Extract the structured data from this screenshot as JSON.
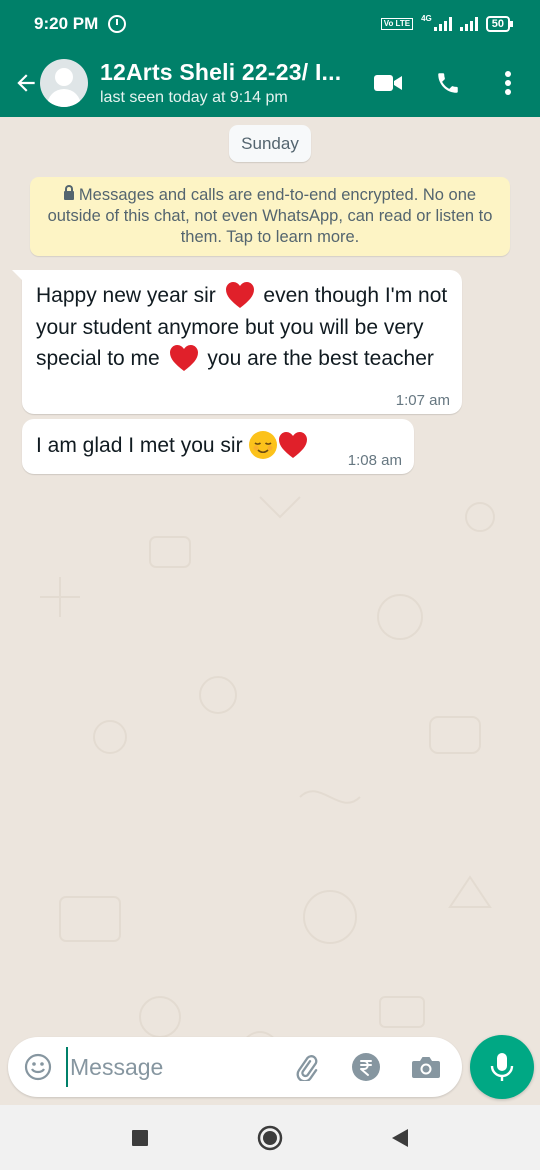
{
  "status_bar": {
    "time": "9:20 PM",
    "network": "4G",
    "volte": "Vo LTE",
    "battery": "50"
  },
  "header": {
    "contact_name": "12Arts Sheli 22-23/ I...",
    "last_seen": "last seen today at 9:14 pm",
    "icons": [
      "back-arrow-icon",
      "avatar",
      "video-call-icon",
      "phone-icon",
      "more-vert-icon"
    ]
  },
  "chat": {
    "date_chip": "Sunday",
    "encryption_notice": "Messages and calls are end-to-end encrypted. No one outside of this chat, not even WhatsApp, can read or listen to them. Tap to learn more.",
    "messages": [
      {
        "parts": [
          "Happy new year sir ",
          " even though I'm not your student anymore but you will be very special to me ",
          " you are the best teacher"
        ],
        "time": "1:07 am"
      },
      {
        "parts": [
          "I am glad I met you sir "
        ],
        "time": "1:08 am"
      }
    ]
  },
  "input_bar": {
    "placeholder": "Message",
    "icons": [
      "emoji-icon",
      "attach-icon",
      "rupee-payment-icon",
      "camera-icon",
      "mic-icon"
    ]
  },
  "colors": {
    "header": "#008069",
    "chat_bg": "#ece5dd",
    "mic_button": "#00a884",
    "notice_bg": "#fdf4c5"
  }
}
